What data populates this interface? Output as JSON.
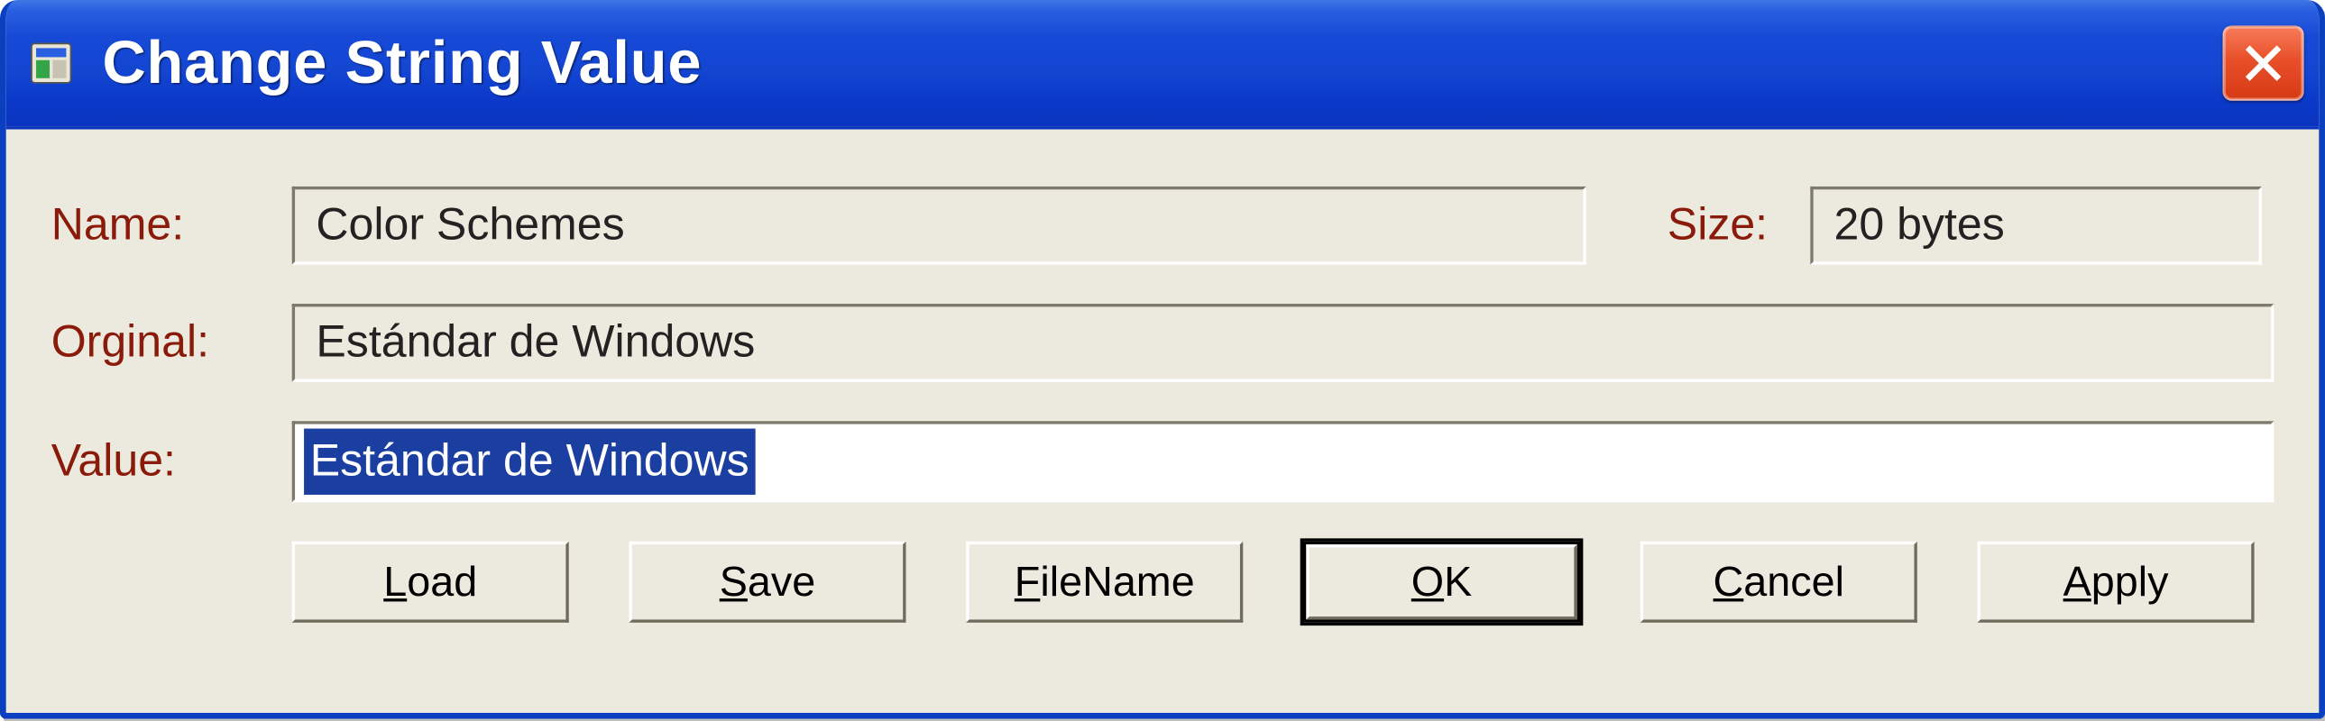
{
  "window": {
    "title": "Change String Value"
  },
  "labels": {
    "name": "Name:",
    "original": "Orginal:",
    "value": "Value:",
    "size": "Size:"
  },
  "fields": {
    "name": "Color Schemes",
    "size": "20 bytes",
    "original": "Estándar de Windows",
    "value": "Estándar de Windows"
  },
  "buttons": {
    "load": {
      "pre": "",
      "accel": "L",
      "post": "oad"
    },
    "save": {
      "pre": "",
      "accel": "S",
      "post": "ave"
    },
    "filename": {
      "pre": "",
      "accel": "F",
      "post": "ileName"
    },
    "ok": {
      "pre": "",
      "accel": "O",
      "post": "K"
    },
    "cancel": {
      "pre": "",
      "accel": "C",
      "post": "ancel"
    },
    "apply": {
      "pre": "",
      "accel": "A",
      "post": "pply"
    }
  }
}
